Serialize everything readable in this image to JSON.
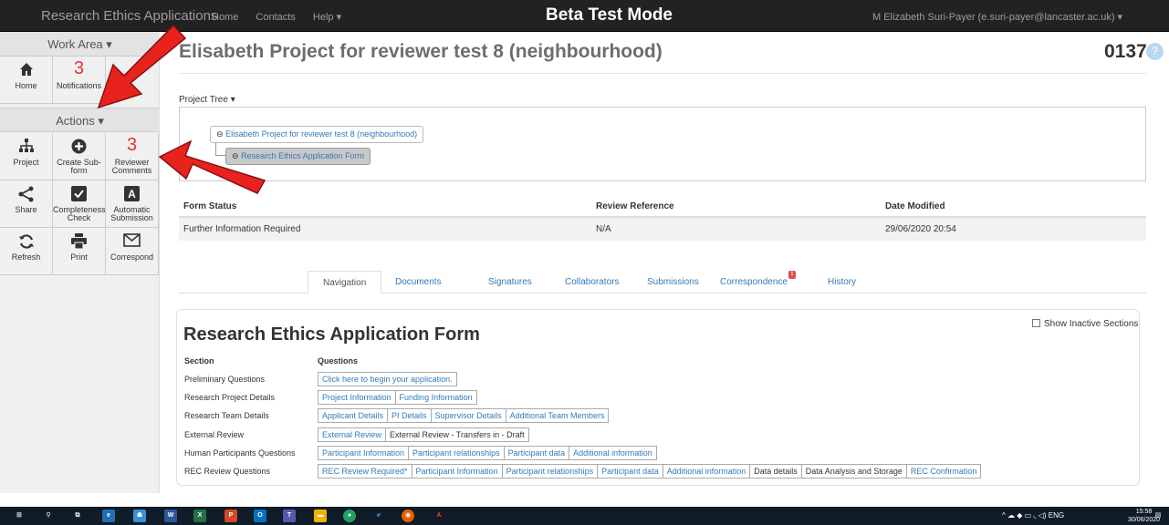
{
  "topbar": {
    "brand": "Research Ethics Applications",
    "nav": [
      "Home",
      "Contacts",
      "Help ▾"
    ],
    "mode": "Beta Test Mode",
    "user": "M Elizabeth Suri-Payer (e.suri-payer@lancaster.ac.uk) ▾"
  },
  "sidebar": {
    "work_area": "Work Area ▾",
    "actions": "Actions ▾",
    "home": "Home",
    "notifications_count": "3",
    "notifications": "Notifications",
    "project": "Project",
    "create_sub": "Create Sub-form",
    "reviewer_count": "3",
    "reviewer": "Reviewer Comments",
    "share": "Share",
    "completeness": "Completeness Check",
    "automatic": "Automatic Submission",
    "refresh": "Refresh",
    "print": "Print",
    "correspond": "Correspond"
  },
  "page": {
    "title": "Elisabeth Project for reviewer test 8 (neighbourhood)",
    "number": "0137",
    "help": "?",
    "project_tree_label": "Project Tree ▾",
    "tree_root": "Elisabeth Project for reviewer test 8 (neighbourhood)",
    "tree_child": "Research Ethics Application Form"
  },
  "status_table": {
    "headers": [
      "Form Status",
      "Review Reference",
      "Date Modified"
    ],
    "row": [
      "Further Information Required",
      "N/A",
      "29/06/2020 20:54"
    ]
  },
  "tabs": [
    "Navigation",
    "Documents",
    "Signatures",
    "Collaborators",
    "Submissions",
    "Correspondence",
    "History"
  ],
  "correspondence_badge": "1",
  "form": {
    "title": "Research Ethics Application Form",
    "show_inactive": "Show Inactive Sections",
    "col_section": "Section",
    "col_questions": "Questions",
    "rows": [
      {
        "section": "Preliminary Questions",
        "questions": [
          "Click here to begin your application."
        ]
      },
      {
        "section": "Research Project Details",
        "questions": [
          "Project Information",
          "Funding Information"
        ]
      },
      {
        "section": "Research Team Details",
        "questions": [
          "Applicant Details",
          "PI Details",
          "Supervisor Details",
          "Additional Team Members"
        ]
      },
      {
        "section": "External Review",
        "questions": [
          "External Review",
          "External Review - Transfers in - Draft"
        ]
      },
      {
        "section": "Human Participants Questions",
        "questions": [
          "Participant Information",
          "Participant relationships",
          "Participant data",
          "Additional information"
        ]
      },
      {
        "section": "REC Review Questions",
        "questions": [
          "REC Review Required*",
          "Participant Information",
          "Participant relationships",
          "Participant data",
          "Additional information",
          "Data details",
          "Data Analysis and Storage",
          "REC Confirmation"
        ]
      }
    ]
  },
  "taskbar": {
    "tray_lang": "ENG",
    "time": "15:58",
    "date": "30/06/2020"
  },
  "colors": {
    "navbar": "#222222",
    "accent_red": "#e0353a",
    "link": "#337ab7",
    "arrow": "#e8231e"
  }
}
